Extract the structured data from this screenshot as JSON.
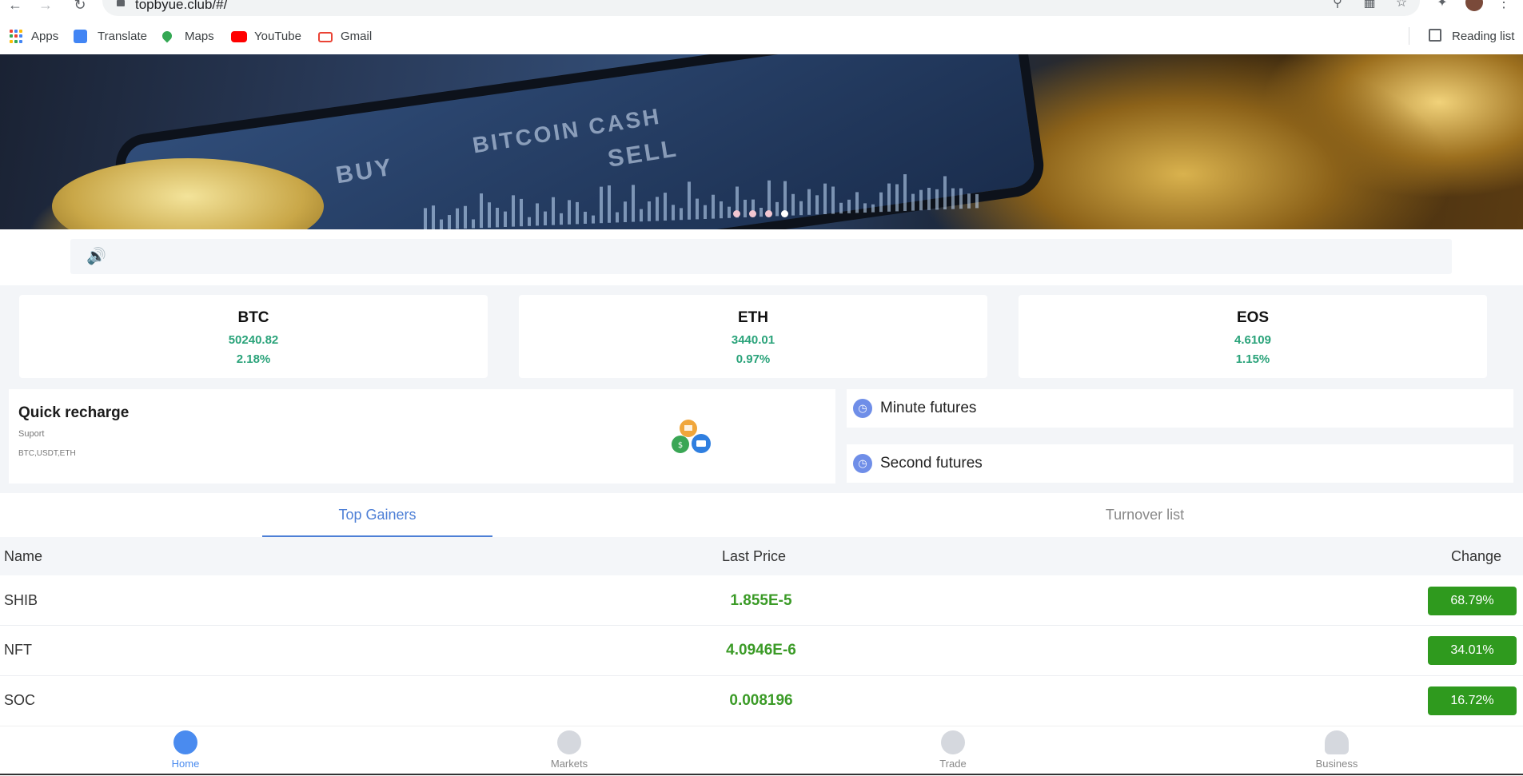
{
  "browser": {
    "url": "topbyue.club/#/",
    "bookmarks": [
      "Apps",
      "Translate",
      "Maps",
      "YouTube",
      "Gmail"
    ],
    "reading_list": "Reading list"
  },
  "banner": {
    "texts": [
      "BITCOIN CASH",
      "BUY",
      "SELL"
    ],
    "slides": 4,
    "active_slide": 4
  },
  "tickers": [
    {
      "symbol": "BTC",
      "price": "50240.82",
      "change": "2.18%"
    },
    {
      "symbol": "ETH",
      "price": "3440.01",
      "change": "0.97%"
    },
    {
      "symbol": "EOS",
      "price": "4.6109",
      "change": "1.15%"
    }
  ],
  "quick_recharge": {
    "title": "Quick recharge",
    "support_label": "Suport",
    "coins": "BTC,USDT,ETH"
  },
  "futures": [
    {
      "label": "Minute futures"
    },
    {
      "label": "Second futures"
    }
  ],
  "tabs": {
    "gainers": "Top Gainers",
    "turnover": "Turnover list"
  },
  "table": {
    "headers": {
      "name": "Name",
      "last_price": "Last Price",
      "change": "Change"
    },
    "rows": [
      {
        "name": "SHIB",
        "price": "1.855E-5",
        "change": "68.79%"
      },
      {
        "name": "NFT",
        "price": "4.0946E-6",
        "change": "34.01%"
      },
      {
        "name": "SOC",
        "price": "0.008196",
        "change": "16.72%"
      }
    ]
  },
  "nav": [
    "Home",
    "Markets",
    "Trade",
    "Business"
  ],
  "colors": {
    "positive": "#2aa37a",
    "change_badge": "#2f9a1e",
    "accent": "#4d7fd6"
  }
}
